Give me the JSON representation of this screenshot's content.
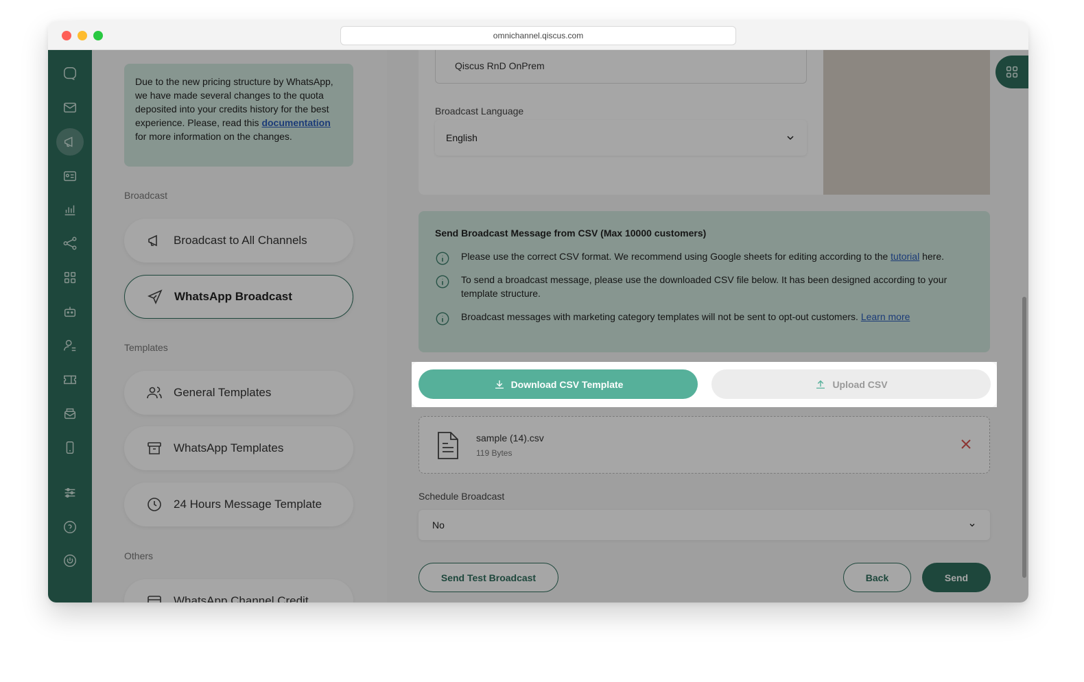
{
  "browser": {
    "url": "omnichannel.qiscus.com"
  },
  "notice": {
    "text_before": "Due to the new pricing structure by WhatsApp, we have made several changes to the quota deposited into your credits history for the best experience. Please, read this ",
    "link": "documentation",
    "text_after": " for more information on the changes."
  },
  "sidebar": {
    "broadcast_section": "Broadcast",
    "broadcast_all": "Broadcast to All Channels",
    "whatsapp_broadcast": "WhatsApp Broadcast",
    "templates_section": "Templates",
    "general_templates": "General Templates",
    "whatsapp_templates": "WhatsApp Templates",
    "hours_template": "24 Hours Message Template",
    "others_section": "Others",
    "channel_credit": "WhatsApp Channel Credit"
  },
  "form": {
    "channel_value": "Qiscus RnD OnPrem",
    "language_label": "Broadcast Language",
    "language_value": "English"
  },
  "csv_info": {
    "title": "Send Broadcast Message from CSV (Max 10000 customers)",
    "line1_before": "Please use the correct CSV format. We recommend using Google sheets for editing according to the ",
    "line1_link": "tutorial",
    "line1_after": " here.",
    "line2": "To send a broadcast message, please use the downloaded CSV file below. It has been designed according to your template structure.",
    "line3_before": "Broadcast messages with marketing category templates will not be sent to opt-out customers. ",
    "line3_link": "Learn more"
  },
  "buttons": {
    "download": "Download CSV Template",
    "upload": "Upload CSV",
    "send_test": "Send Test Broadcast",
    "back": "Back",
    "send": "Send"
  },
  "file": {
    "name": "sample (14).csv",
    "size": "119 Bytes"
  },
  "schedule": {
    "label": "Schedule Broadcast",
    "value": "No"
  },
  "colors": {
    "brand": "#2f6e5d",
    "accent": "#56b09a",
    "info_bg": "#cfe6dd",
    "danger": "#d9534f"
  }
}
